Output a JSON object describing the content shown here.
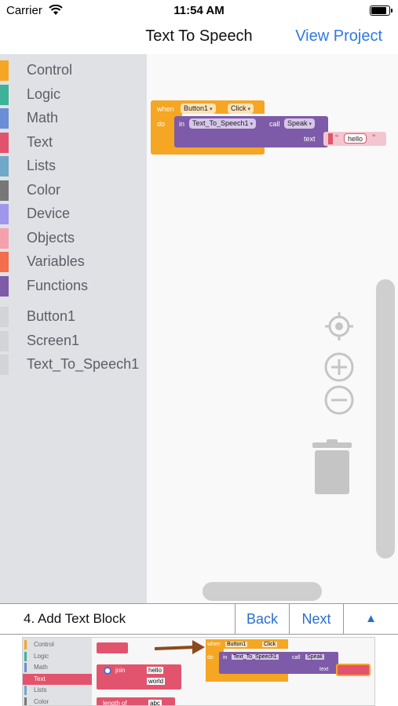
{
  "status_bar": {
    "carrier": "Carrier",
    "time": "11:54 AM",
    "battery_level": 0.9
  },
  "nav": {
    "title": "Text To Speech",
    "action_label": "View Project"
  },
  "toolbox": {
    "categories": [
      {
        "label": "Control",
        "color": "#f5a623"
      },
      {
        "label": "Logic",
        "color": "#3fb39a"
      },
      {
        "label": "Math",
        "color": "#6b8ed6"
      },
      {
        "label": "Text",
        "color": "#e2546d"
      },
      {
        "label": "Lists",
        "color": "#6fa8c9"
      },
      {
        "label": "Color",
        "color": "#777777"
      },
      {
        "label": "Device",
        "color": "#9f97ec"
      },
      {
        "label": "Objects",
        "color": "#f3a1ad"
      },
      {
        "label": "Variables",
        "color": "#f26e4c"
      },
      {
        "label": "Functions",
        "color": "#7e5ba8"
      }
    ],
    "components": [
      {
        "label": "Button1"
      },
      {
        "label": "Screen1"
      },
      {
        "label": "Text_To_Speech1"
      }
    ]
  },
  "blocks": {
    "when_label": "when",
    "component": "Button1",
    "event": "Click",
    "do_label": "do",
    "in_label": "in",
    "tts_component": "Text_To_Speech1",
    "call_label": "call",
    "method": "Speak",
    "text_param": "text",
    "string_open": "“",
    "string_value": "hello",
    "string_close": "”",
    "colors": {
      "event": "#f5a623",
      "method": "#7e5ba8",
      "text": "#e2546d"
    }
  },
  "tutorial": {
    "step_title": "4. Add Text Block",
    "back_label": "Back",
    "next_label": "Next",
    "toggle_icon": "▲"
  },
  "preview": {
    "categories": [
      "Control",
      "Logic",
      "Math",
      "Text",
      "Lists",
      "Color"
    ],
    "join_label": "join",
    "join_values": [
      "hello",
      "world"
    ],
    "length_label": "length of",
    "length_value": "abc",
    "when_label": "when",
    "component": "Button1",
    "event": "Click",
    "do_label": "do",
    "in_label": "in",
    "tts_component": "Text_To_Speech1",
    "call_label": "call",
    "method": "Speak",
    "text_param": "text"
  }
}
